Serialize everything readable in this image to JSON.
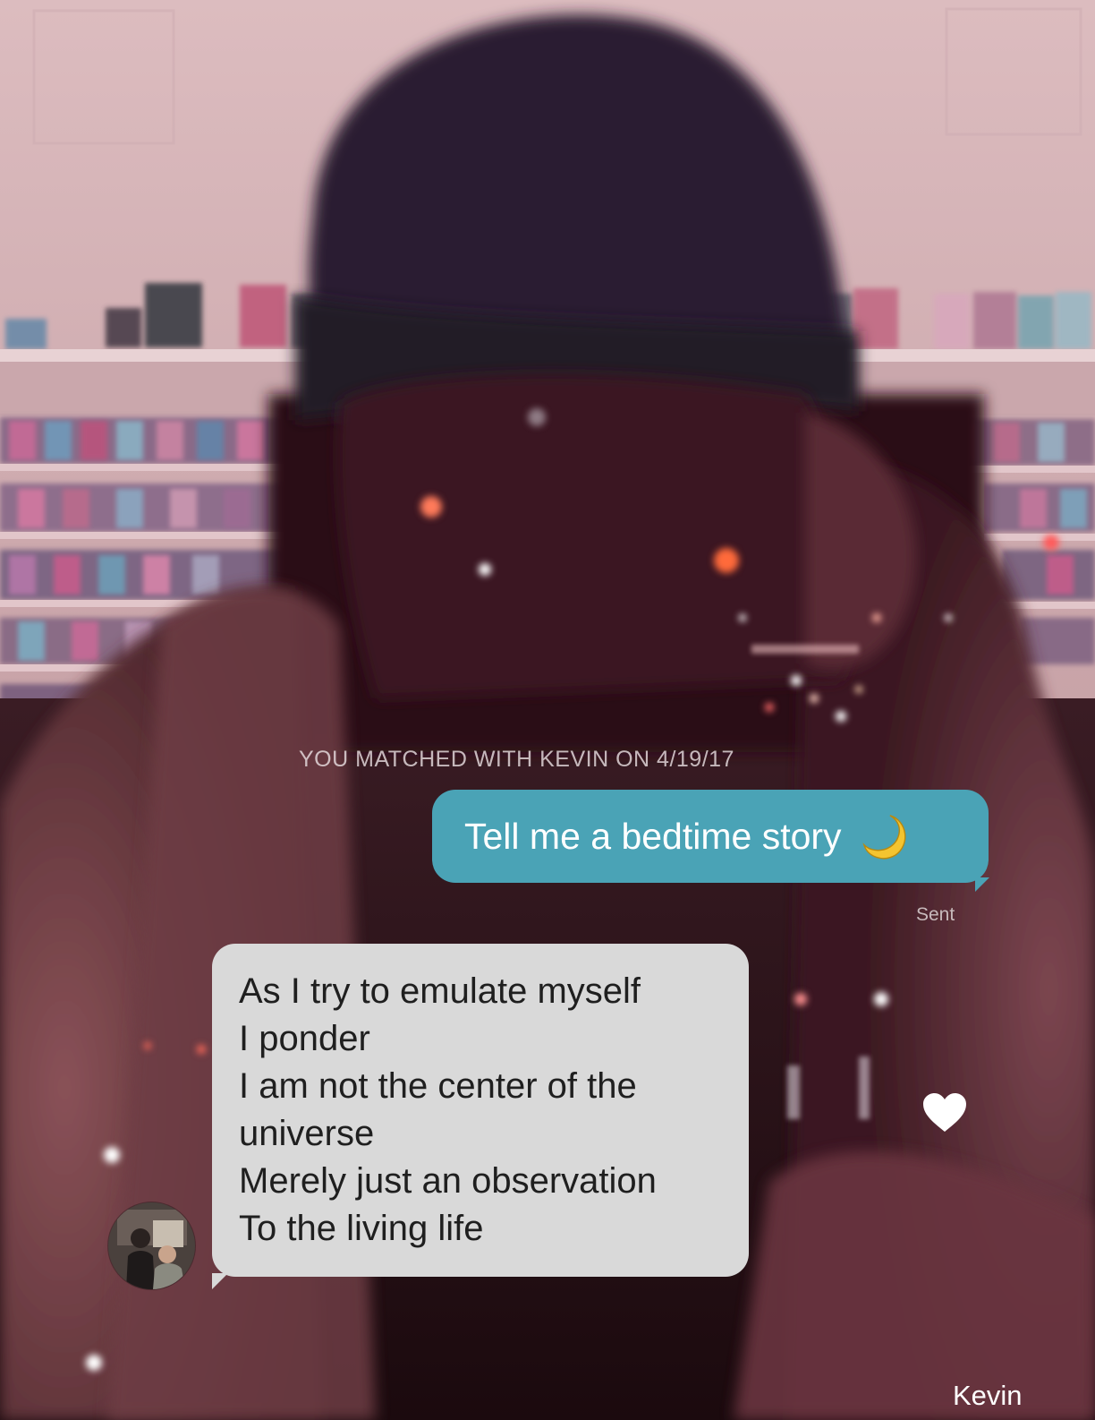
{
  "chat": {
    "match_banner": "YOU MATCHED WITH KEVIN ON 4/19/17",
    "messages": [
      {
        "direction": "sent",
        "text": "Tell me a bedtime story",
        "emoji_icon": "crescent-moon-icon",
        "status": "Sent",
        "bubble_color": "#4aa3b6"
      },
      {
        "direction": "received",
        "lines": [
          "As I try to emulate myself",
          "I ponder",
          "I am not the center of the",
          "universe",
          "Merely just an observation",
          "To the living life"
        ],
        "bubble_color": "#d9d9d9",
        "liked": true,
        "reaction_icon": "heart-icon"
      }
    ],
    "sender_name": "Kevin",
    "avatar_icon": "profile-photo-avatar"
  },
  "colors": {
    "sent_bubble": "#4aa3b6",
    "received_bubble": "#d9d9d9",
    "background_tint": "#4a1f26"
  }
}
